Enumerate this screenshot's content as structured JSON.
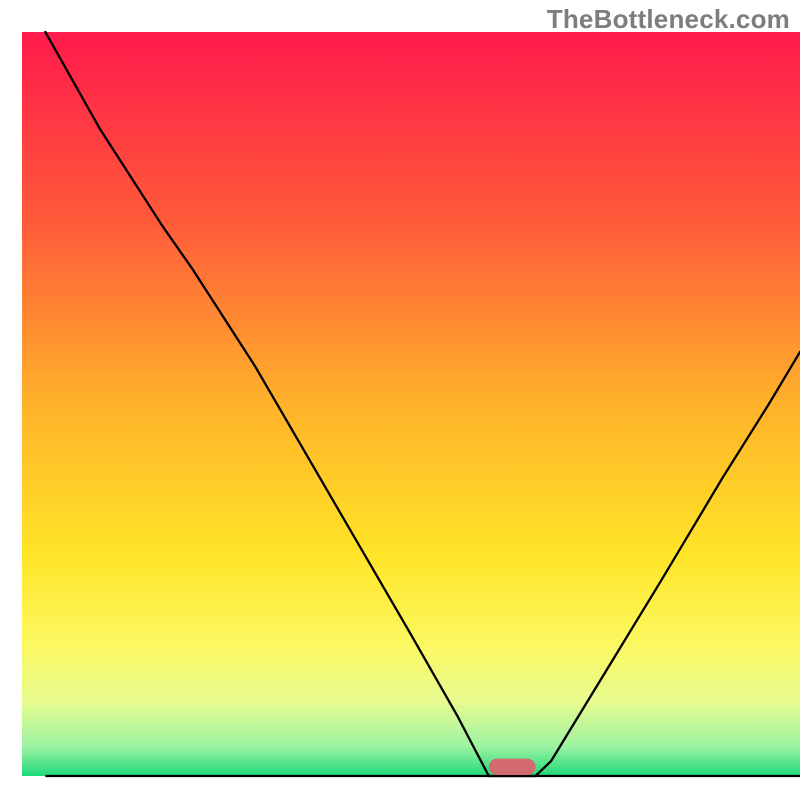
{
  "watermark": "TheBottleneck.com",
  "chart_data": {
    "type": "line",
    "title": "",
    "xlabel": "",
    "ylabel": "",
    "xlim": [
      0,
      100
    ],
    "ylim": [
      0,
      100
    ],
    "background_gradient": {
      "stops": [
        {
          "offset": 0,
          "color": "#ff1a4b"
        },
        {
          "offset": 25,
          "color": "#ff593a"
        },
        {
          "offset": 50,
          "color": "#ffb22a"
        },
        {
          "offset": 70,
          "color": "#ffe427"
        },
        {
          "offset": 82,
          "color": "#fcf85f"
        },
        {
          "offset": 90,
          "color": "#e7fb8f"
        },
        {
          "offset": 96,
          "color": "#9df3a2"
        },
        {
          "offset": 100,
          "color": "#1fd97a"
        }
      ]
    },
    "series": [
      {
        "name": "bottleneck-curve",
        "type": "line",
        "color": "#000000",
        "stroke_width": 2.3,
        "points": [
          {
            "x": 3,
            "y": 100
          },
          {
            "x": 10,
            "y": 87
          },
          {
            "x": 18,
            "y": 74
          },
          {
            "x": 22,
            "y": 68
          },
          {
            "x": 30,
            "y": 55
          },
          {
            "x": 40,
            "y": 37
          },
          {
            "x": 50,
            "y": 19
          },
          {
            "x": 56,
            "y": 8
          },
          {
            "x": 59,
            "y": 2
          },
          {
            "x": 60,
            "y": 0
          },
          {
            "x": 66,
            "y": 0
          },
          {
            "x": 68,
            "y": 2
          },
          {
            "x": 75,
            "y": 14
          },
          {
            "x": 82,
            "y": 26
          },
          {
            "x": 90,
            "y": 40
          },
          {
            "x": 96,
            "y": 50
          },
          {
            "x": 100,
            "y": 57
          }
        ]
      }
    ],
    "marker": {
      "color": "#d36a6f",
      "x_center": 63,
      "width": 6,
      "height": 2.2,
      "rx": 1.1
    },
    "baseline": {
      "color": "#000000",
      "stroke_width": 2.3,
      "y": 0,
      "x0": 3,
      "x1": 100
    }
  }
}
